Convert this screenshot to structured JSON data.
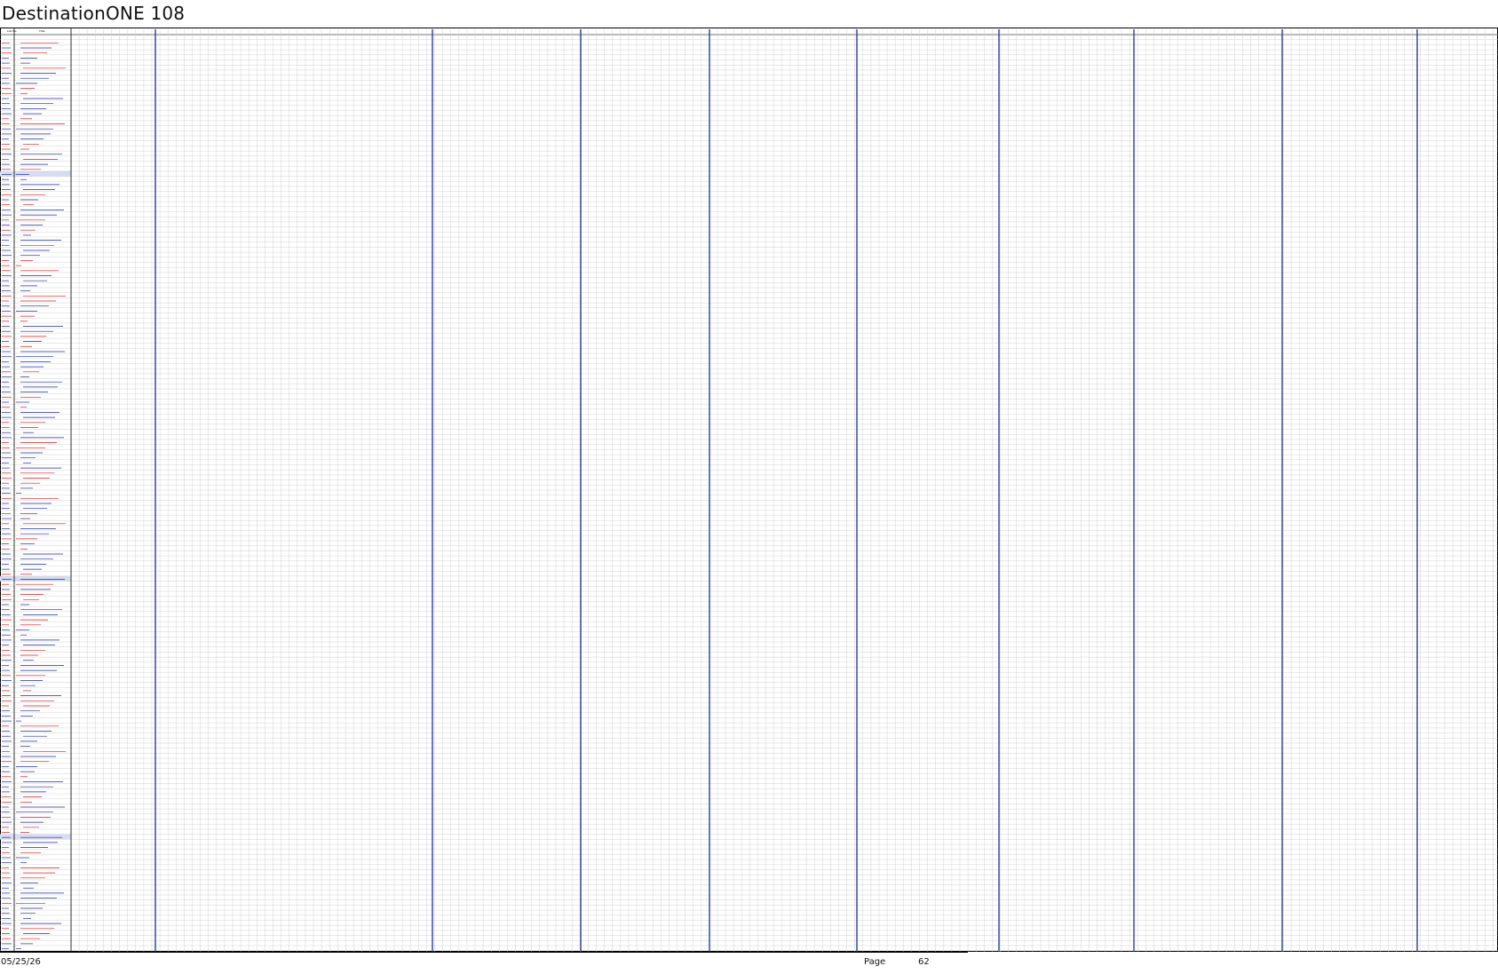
{
  "document": {
    "title": "DestinationONE 108"
  },
  "table": {
    "header_id": "List No.",
    "header_name": "Title"
  },
  "footer": {
    "date": "05/25/26",
    "page_label": "Page",
    "page_number": "62"
  },
  "colors": {
    "grid": "#c8c8c8",
    "grid_dark": "#000000",
    "section_divider": "#2a3bb0",
    "row_text_blue": "#1f2f9a",
    "row_text_red": "#d02020",
    "highlight_row": "#d8dcf0"
  }
}
